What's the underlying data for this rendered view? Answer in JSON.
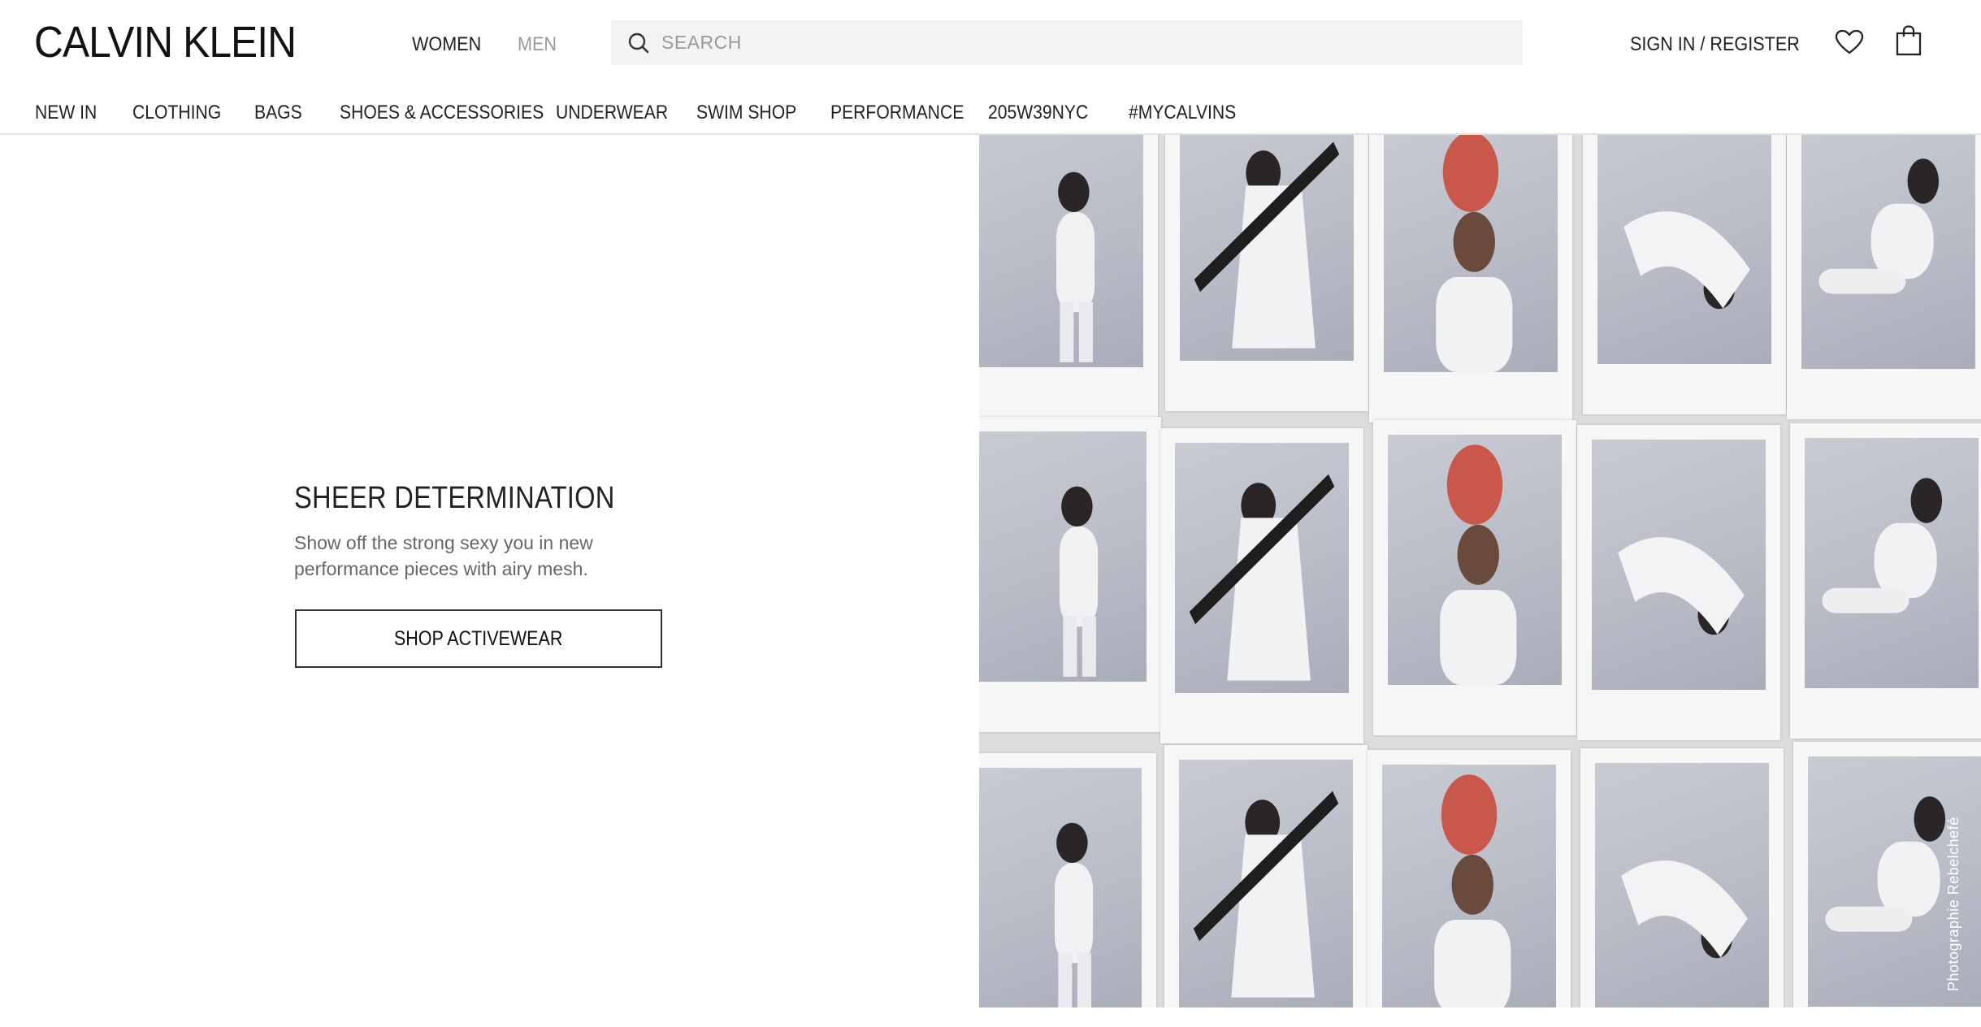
{
  "header": {
    "logo": "CALVIN KLEIN",
    "gender_tabs": [
      "WOMEN",
      "MEN"
    ],
    "active_gender": "WOMEN",
    "search_placeholder": "SEARCH",
    "signin_label": "SIGN IN / REGISTER",
    "icons": {
      "search": "search-icon",
      "wishlist": "heart-icon",
      "cart": "shopping-bag-icon"
    }
  },
  "nav": {
    "items": [
      "NEW IN",
      "CLOTHING",
      "BAGS",
      "SHOES & ACCESSORIES",
      "UNDERWEAR",
      "SWIM SHOP",
      "PERFORMANCE",
      "205W39NYC",
      "#MYCALVINS"
    ]
  },
  "hero": {
    "title": "SHEER DETERMINATION",
    "body": "Show off the strong sexy you in new performance pieces with airy mesh.",
    "cta_label": "SHOP ACTIVEWEAR",
    "photo_credit": "Photographie Rebelchefé"
  },
  "colors": {
    "text": "#1a1a1a",
    "muted": "#9a9a9a",
    "search_bg": "#f3f3f3",
    "nav_border": "#e3e3e3",
    "collage_bg": "#dcdcde",
    "polaroid_frame": "#f6f6f7",
    "photo_bg": "#c4c7d0"
  }
}
